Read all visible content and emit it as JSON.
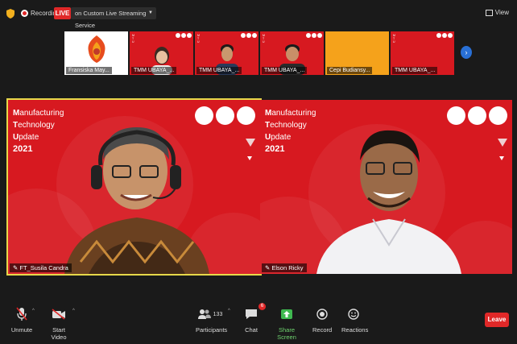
{
  "topbar": {
    "recording_label": "Recording",
    "live_label": "LIVE",
    "stream_target": "on Custom Live Streaming Service",
    "view_label": "View"
  },
  "thumbnails": [
    {
      "name": "Fransiska May..."
    },
    {
      "name": "TMM UBAYA_..."
    },
    {
      "name": "TMM UBAYA_..."
    },
    {
      "name": "TMM UBAYA_..."
    },
    {
      "name": "Cepi Budiansy..."
    },
    {
      "name": "TMM UBAYA_..."
    }
  ],
  "slide": {
    "line1_initial": "M",
    "line1_rest": "anufacturing",
    "line2_initial": "T",
    "line2_rest": "echnology",
    "line3_initial": "U",
    "line3_rest": "pdate",
    "year": "2021"
  },
  "tiles": [
    {
      "name": "FT_Susila Candra"
    },
    {
      "name": "Elson Ricky"
    }
  ],
  "toolbar": {
    "unmute": "Unmute",
    "start_video": "Start Video",
    "participants": "Participants",
    "participants_count": "133",
    "chat": "Chat",
    "chat_badge": "6",
    "share_screen": "Share Screen",
    "record": "Record",
    "reactions": "Reactions",
    "leave": "Leave"
  },
  "colors": {
    "slide_red": "#d71920",
    "live_red": "#e02828",
    "share_green": "#6fd36f",
    "active_border": "#e6d84a"
  }
}
